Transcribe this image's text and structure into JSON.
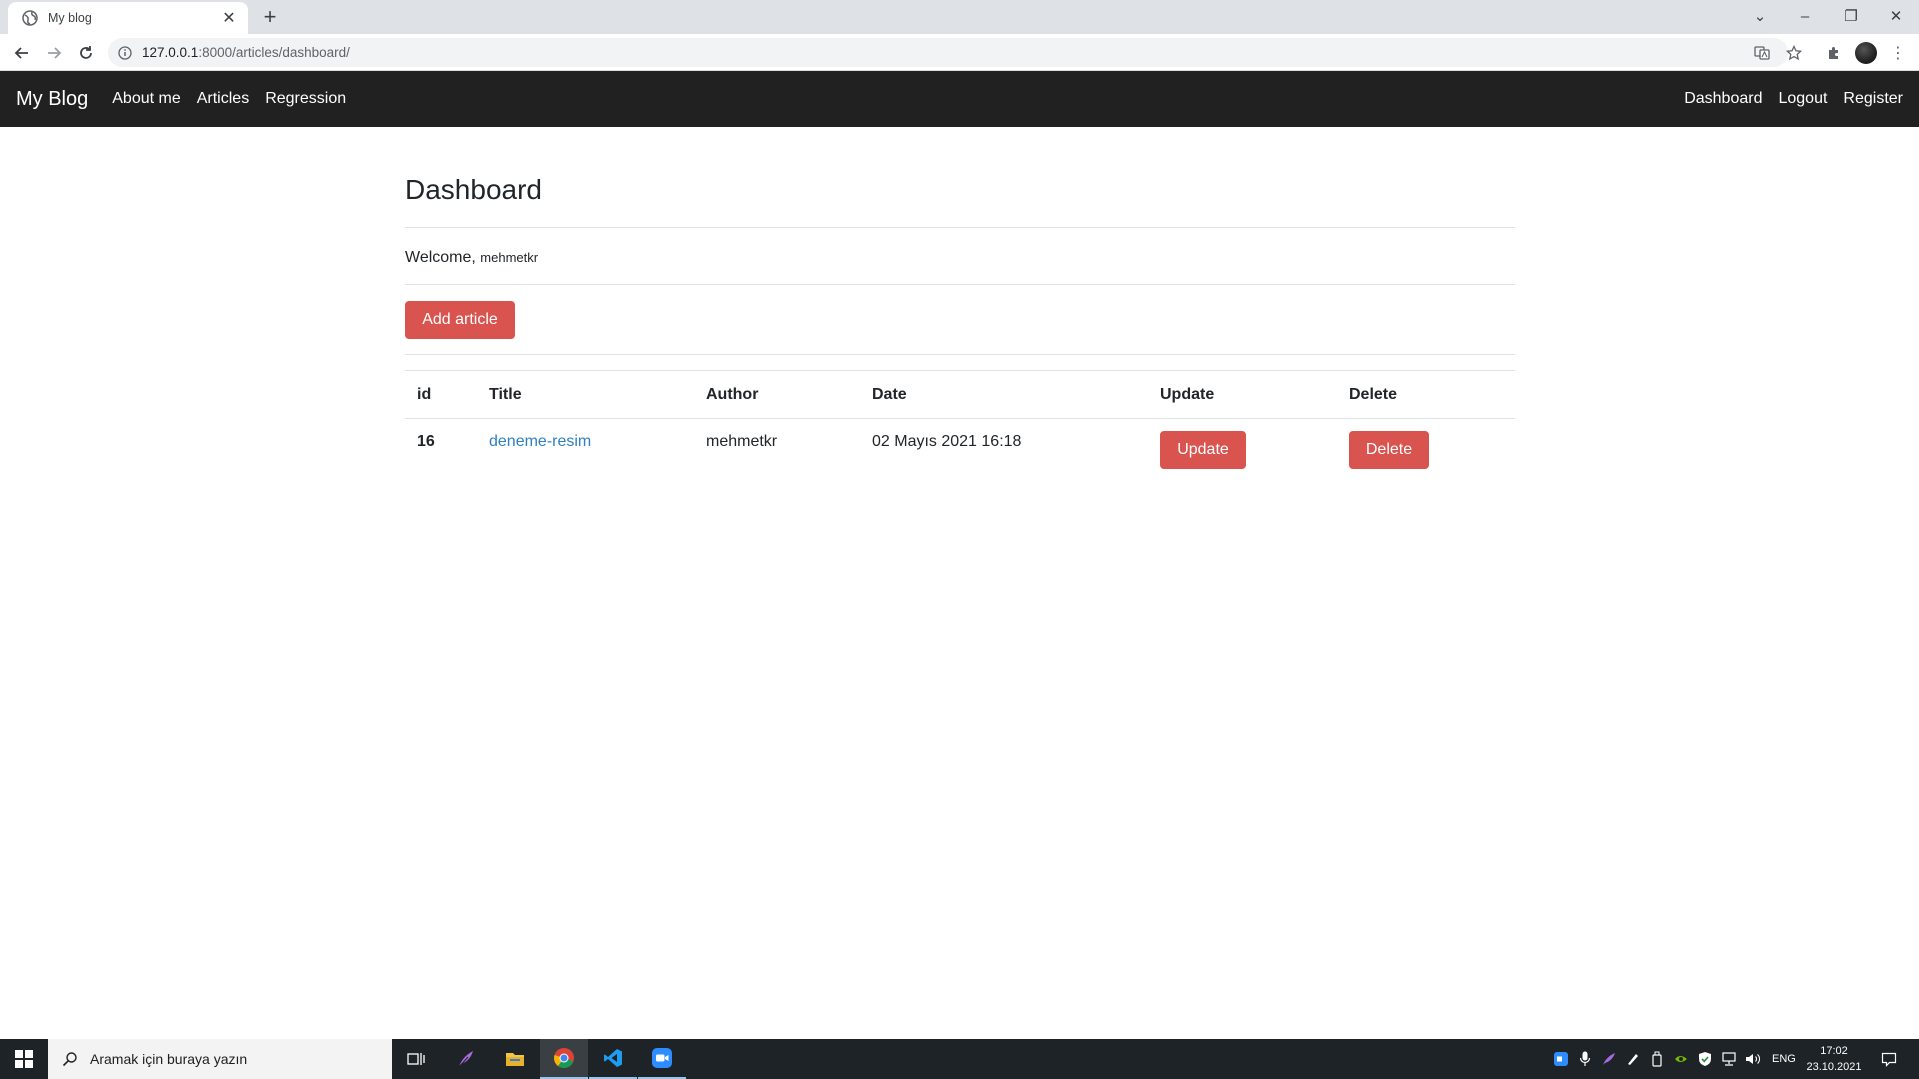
{
  "browser": {
    "tab_title": "My blog",
    "url_host": "127.0.0.1",
    "url_path": ":8000/articles/dashboard/"
  },
  "navbar": {
    "brand": "My Blog",
    "left_links": [
      "About me",
      "Articles",
      "Regression"
    ],
    "right_links": [
      "Dashboard",
      "Logout",
      "Register"
    ]
  },
  "page": {
    "title": "Dashboard",
    "welcome_prefix": "Welcome,",
    "username": "mehmetkr",
    "add_button": "Add article"
  },
  "table": {
    "headers": [
      "id",
      "Title",
      "Author",
      "Date",
      "Update",
      "Delete"
    ],
    "rows": [
      {
        "id": "16",
        "title": "deneme-resim",
        "author": "mehmetkr",
        "date": "02 Mayıs 2021 16:18",
        "update_label": "Update",
        "delete_label": "Delete"
      }
    ]
  },
  "taskbar": {
    "search_placeholder": "Aramak için buraya yazın",
    "language": "ENG",
    "time": "17:02",
    "date": "23.10.2021"
  },
  "colors": {
    "navbar_bg": "#212121",
    "danger": "#d9534f",
    "link": "#2f7fc1"
  }
}
